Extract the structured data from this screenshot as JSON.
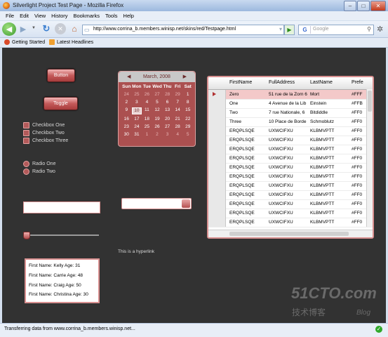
{
  "window": {
    "title": "Silverlight Project Test Page - Mozilla Firefox"
  },
  "menu": [
    "File",
    "Edit",
    "View",
    "History",
    "Bookmarks",
    "Tools",
    "Help"
  ],
  "navigation": {
    "url": "http://www.corrina_b.members.winisp.net/skins/red/Testpage.html",
    "search_engine": "G",
    "search_placeholder": "Google"
  },
  "bookmarks": [
    "Getting Started",
    "Latest Headlines"
  ],
  "controls": {
    "button_label": "Button",
    "toggle_label": "Toggle",
    "checkboxes": [
      "Checkbox One",
      "Checkbox Two",
      "Checkbox Three"
    ],
    "radios": [
      "Radio One",
      "Radio Two"
    ],
    "hyperlink": "This is a hyperlink",
    "slider_value": 0
  },
  "calendar": {
    "month": "March, 2008",
    "prev": "◀",
    "next": "▶",
    "day_names": [
      "Sun",
      "Mon",
      "Tue",
      "Wed",
      "Thu",
      "Fri",
      "Sat"
    ],
    "weeks": [
      [
        "24",
        "25",
        "26",
        "27",
        "28",
        "29",
        "1"
      ],
      [
        "2",
        "3",
        "4",
        "5",
        "6",
        "7",
        "8"
      ],
      [
        "9",
        "10",
        "11",
        "12",
        "13",
        "14",
        "15"
      ],
      [
        "16",
        "17",
        "18",
        "19",
        "20",
        "21",
        "22"
      ],
      [
        "23",
        "24",
        "25",
        "26",
        "27",
        "28",
        "29"
      ],
      [
        "30",
        "31",
        "1",
        "2",
        "3",
        "4",
        "5"
      ]
    ],
    "today": "10"
  },
  "datagrid": {
    "columns": [
      "FirstName",
      "FullAddress",
      "LastName",
      "Prefe"
    ],
    "rows": [
      [
        "Zero",
        "51 rue de la Zorn 6",
        "Mort",
        "#FFF"
      ],
      [
        "One",
        "4 Avenue de la Lib",
        "Einstein",
        "#FFB"
      ],
      [
        "Two",
        "7 rue Nationale, 6",
        "Bitdiddle",
        "#FF0"
      ],
      [
        "Three",
        "10 Place de Borde",
        "Schmoblutz",
        "#FF0"
      ],
      [
        "ERQPLSQE",
        "UXWCIFXU",
        "KLBMVPTT",
        "#FF0"
      ],
      [
        "ERQPLSQE",
        "UXWCIFXU",
        "KLBMVPTT",
        "#FF0"
      ],
      [
        "ERQPLSQE",
        "UXWCIFXU",
        "KLBMVPTT",
        "#FF0"
      ],
      [
        "ERQPLSQE",
        "UXWCIFXU",
        "KLBMVPTT",
        "#FF0"
      ],
      [
        "ERQPLSQE",
        "UXWCIFXU",
        "KLBMVPTT",
        "#FF0"
      ],
      [
        "ERQPLSQE",
        "UXWCIFXU",
        "KLBMVPTT",
        "#FF0"
      ],
      [
        "ERQPLSQE",
        "UXWCIFXU",
        "KLBMVPTT",
        "#FF0"
      ],
      [
        "ERQPLSQE",
        "UXWCIFXU",
        "KLBMVPTT",
        "#FF0"
      ],
      [
        "ERQPLSQE",
        "UXWCIFXU",
        "KLBMVPTT",
        "#FF0"
      ],
      [
        "ERQPLSQE",
        "UXWCIFXU",
        "KLBMVPTT",
        "#FF0"
      ],
      [
        "ERQPLSQE",
        "UXWCIFXU",
        "KLBMVPTT",
        "#FF0"
      ]
    ]
  },
  "listbox": [
    "First Name:  Kelly   Age:  31",
    "First Name:  Carrie   Age:  48",
    "First Name:  Craig   Age:  50",
    "First Name:  Christina   Age:  30"
  ],
  "status": "Transferring data from www.corrina_b.members.winisp.net...",
  "watermark": {
    "logo": "51CTO.com",
    "sub": "技术博客",
    "blog": "Blog"
  },
  "colors": {
    "accent": "#c45a5a",
    "background": "#323232"
  }
}
